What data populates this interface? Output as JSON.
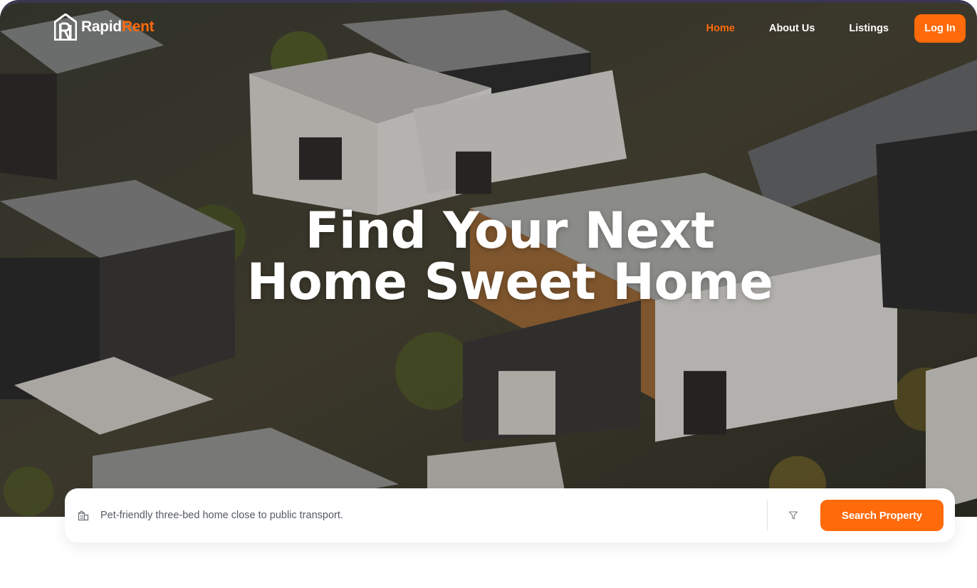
{
  "brand": {
    "name_part1": "Rapid",
    "name_part2": "Rent",
    "accent_color": "#ff6a0a"
  },
  "nav": {
    "items": [
      {
        "label": "Home",
        "active": true
      },
      {
        "label": "About Us",
        "active": false
      },
      {
        "label": "Listings",
        "active": false
      }
    ],
    "login_label": "Log In"
  },
  "hero": {
    "headline_line1": "Find Your Next",
    "headline_line2": "Home Sweet Home",
    "background": "aerial-modern-houses-image"
  },
  "search": {
    "icon": "building-icon",
    "value": "Pet-friendly three-bed home close to public transport.",
    "filter_icon": "filter-icon",
    "button_label": "Search Property"
  }
}
